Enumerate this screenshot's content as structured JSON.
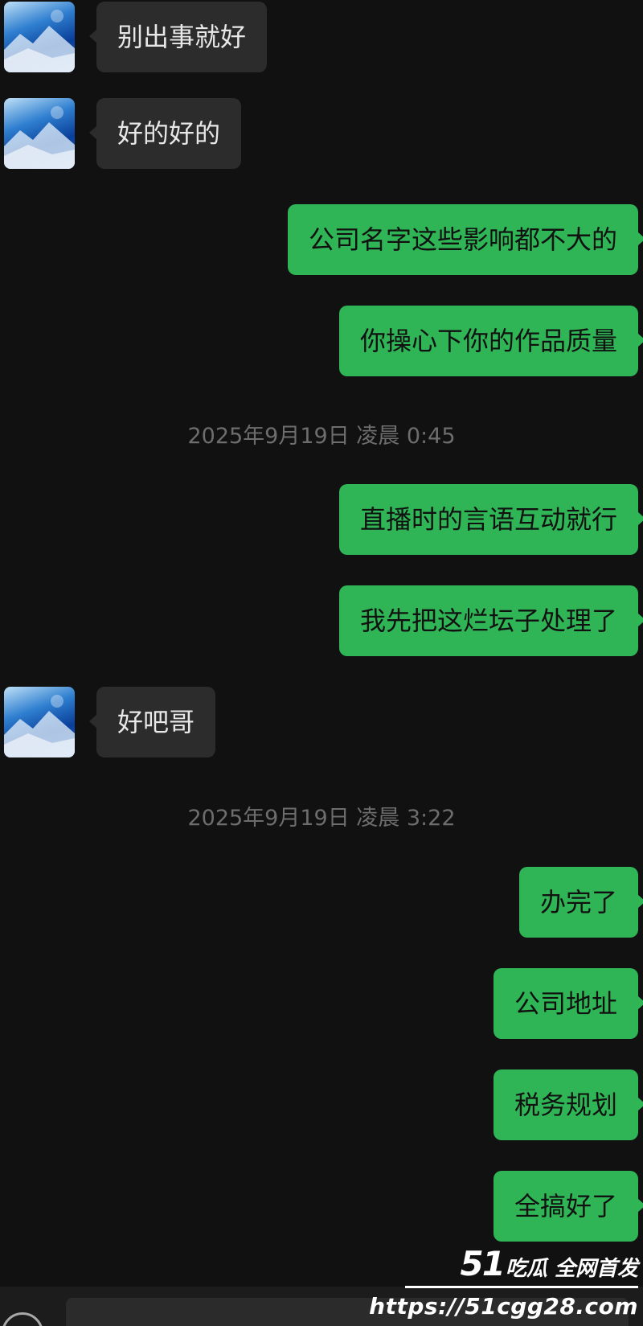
{
  "conversation": {
    "messages": [
      {
        "direction": "in",
        "text": "别出事就好"
      },
      {
        "direction": "in",
        "text": "好的好的"
      },
      {
        "direction": "out",
        "text": "公司名字这些影响都不大的"
      },
      {
        "direction": "out",
        "text": "你操心下你的作品质量"
      },
      {
        "direction": "time",
        "text": "2025年9月19日 凌晨 0:45"
      },
      {
        "direction": "out",
        "text": "直播时的言语互动就行"
      },
      {
        "direction": "out",
        "text": "我先把这烂坛子处理了"
      },
      {
        "direction": "in",
        "text": "好吧哥"
      },
      {
        "direction": "time",
        "text": "2025年9月19日 凌晨 3:22"
      },
      {
        "direction": "out",
        "text": "办完了"
      },
      {
        "direction": "out",
        "text": "公司地址"
      },
      {
        "direction": "out",
        "text": "税务规划"
      },
      {
        "direction": "out",
        "text": "全搞好了"
      }
    ]
  },
  "watermark": {
    "logo_number": "51",
    "logo_text": "吃瓜 全网首发",
    "url": "https://51cgg28.com"
  },
  "colors": {
    "background": "#111111",
    "incoming_bubble": "#2c2c2c",
    "outgoing_bubble": "#2fb555",
    "timestamp_text": "#6d6d6d"
  },
  "icons": {
    "avatar": "blue-landscape-avatar",
    "voice": "voice-icon"
  }
}
